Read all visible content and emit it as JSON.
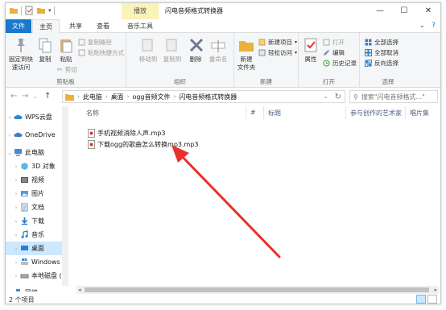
{
  "window": {
    "title": "闪电音频格式转换器",
    "context_tab": "播放",
    "controls": {
      "minimize": "—",
      "maximize": "☐",
      "close": "✕"
    }
  },
  "tabs": {
    "file": "文件",
    "home": "主页",
    "share": "共享",
    "view": "查看",
    "music_tools": "音乐工具"
  },
  "ribbon": {
    "clipboard": {
      "label": "剪贴板",
      "pin": "固定到快\n速访问",
      "copy": "复制",
      "paste": "粘贴",
      "copy_path": "复制路径",
      "paste_shortcut": "粘贴快捷方式",
      "cut": "剪切"
    },
    "organize": {
      "label": "组织",
      "move_to": "移动到",
      "copy_to": "复制到",
      "delete": "删除",
      "rename": "重命名"
    },
    "new": {
      "label": "新建",
      "new_folder": "新建\n文件夹",
      "new_item": "新建项目",
      "easy_access": "轻松访问"
    },
    "open": {
      "label": "打开",
      "properties": "属性",
      "open": "打开",
      "edit": "编辑",
      "history": "历史记录"
    },
    "select": {
      "label": "选择",
      "select_all": "全部选择",
      "select_none": "全部取消",
      "invert": "反向选择"
    }
  },
  "address": {
    "path": [
      "此电脑",
      "桌面",
      "ogg音频文件",
      "闪电音频格式转换器"
    ],
    "search_placeholder": "搜索\"闪电音频格式...\""
  },
  "nav": {
    "items": [
      {
        "label": "WPS云盘"
      },
      {
        "label": "OneDrive"
      },
      {
        "label": "此电脑"
      },
      {
        "label": "3D 对象"
      },
      {
        "label": "视频"
      },
      {
        "label": "图片"
      },
      {
        "label": "文档"
      },
      {
        "label": "下载"
      },
      {
        "label": "音乐"
      },
      {
        "label": "桌面"
      },
      {
        "label": "Windows (C"
      },
      {
        "label": "本地磁盘 (D"
      },
      {
        "label": "网络"
      }
    ]
  },
  "columns": {
    "name": "名称",
    "number": "#",
    "title": "标题",
    "artist": "参与创作的艺术家",
    "album": "唱片集"
  },
  "files": [
    {
      "name": "手机视频消除人声.mp3"
    },
    {
      "name": "下载ogg的歌曲怎么转换mp3.mp3"
    }
  ],
  "status": {
    "count": "2 个项目"
  },
  "colors": {
    "file_tab": "#1979ca",
    "selection": "#cce8ff",
    "arrow": "#e8302a",
    "context_tab": "#fbf2b8"
  }
}
